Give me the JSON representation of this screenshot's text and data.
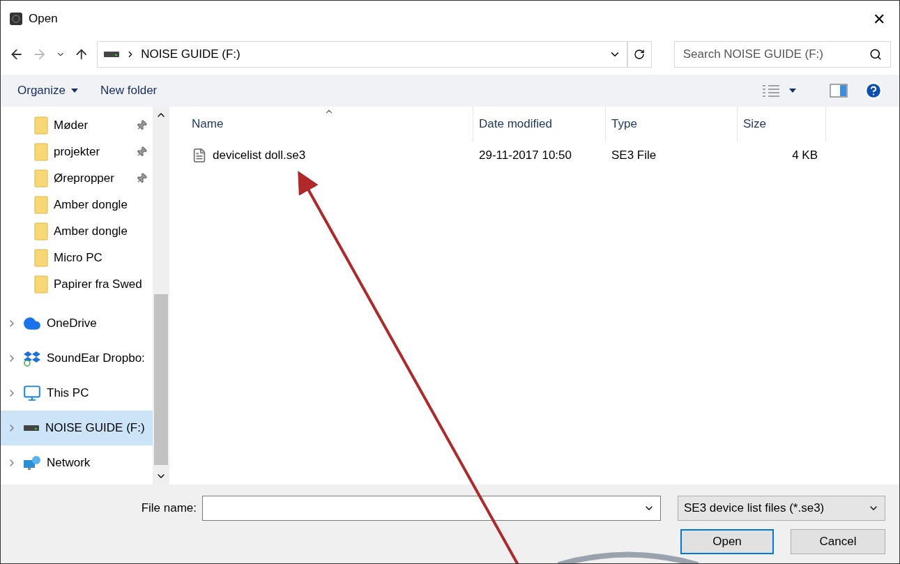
{
  "window": {
    "title": "Open",
    "close": "✕"
  },
  "address_bar": {
    "path": "NOISE GUIDE (F:)"
  },
  "search": {
    "placeholder": "Search NOISE GUIDE (F:)"
  },
  "toolbar": {
    "organize": "Organize",
    "new_folder": "New folder"
  },
  "sidebar": {
    "items": [
      {
        "label": "Møder",
        "kind": "folder",
        "pinned": true,
        "selected": false
      },
      {
        "label": "projekter",
        "kind": "folder",
        "pinned": true,
        "selected": false
      },
      {
        "label": "Ørepropper",
        "kind": "folder",
        "pinned": true,
        "selected": false
      },
      {
        "label": "Amber dongle",
        "kind": "folder",
        "pinned": false,
        "selected": false
      },
      {
        "label": "Amber dongle",
        "kind": "folder",
        "pinned": false,
        "selected": false
      },
      {
        "label": "Micro PC",
        "kind": "folder",
        "pinned": false,
        "selected": false
      },
      {
        "label": "Papirer fra Swed",
        "kind": "folder",
        "pinned": false,
        "selected": false
      },
      {
        "label": "OneDrive",
        "kind": "cloud",
        "expanded": false,
        "selected": false
      },
      {
        "label": "SoundEar Dropbo:",
        "kind": "dropbox",
        "expanded": false,
        "selected": false
      },
      {
        "label": "This PC",
        "kind": "computer",
        "expanded": false,
        "selected": false
      },
      {
        "label": "NOISE GUIDE (F:)",
        "kind": "drive",
        "expanded": false,
        "selected": true
      },
      {
        "label": "Network",
        "kind": "network",
        "expanded": false,
        "selected": false
      }
    ]
  },
  "table": {
    "columns": [
      "Name",
      "Date modified",
      "Type",
      "Size"
    ],
    "rows": [
      {
        "name": "devicelist doll.se3",
        "date_modified": "29-11-2017 10:50",
        "type": "SE3 File",
        "size": "4 KB"
      }
    ]
  },
  "footer": {
    "file_name_label": "File name:",
    "file_type": "SE3 device list files (*.se3)",
    "open": "Open",
    "cancel": "Cancel"
  }
}
